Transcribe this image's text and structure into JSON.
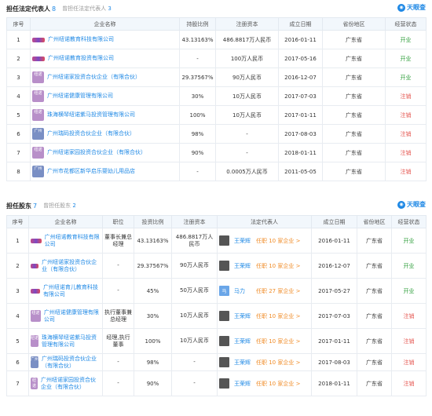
{
  "section1": {
    "title": "担任法定代表人",
    "count": "8",
    "sub_prefix": "曾担任法定代表人",
    "sub_count": "3",
    "logo": "天眼查",
    "headers": [
      "序号",
      "企业名称",
      "持股比例",
      "注册资本",
      "成立日期",
      "省份地区",
      "经营状态"
    ],
    "rows": [
      {
        "no": "1",
        "logo": "",
        "name": "广州纽诺教育科技有限公司",
        "ratio": "43.13163%",
        "capital": "486.8817万人民币",
        "date": "2016-01-11",
        "region": "广东省",
        "status": "开业"
      },
      {
        "no": "2",
        "logo": "",
        "name": "广州纽诺教育投资有限公司",
        "ratio": "-",
        "capital": "100万人民币",
        "date": "2017-05-16",
        "region": "广东省",
        "status": "开业"
      },
      {
        "no": "3",
        "logo": "纽诺",
        "name": "广州纽诺家投资合伙企业（有限合伙）",
        "ratio": "29.37567%",
        "capital": "90万人民币",
        "date": "2016-12-07",
        "region": "广东省",
        "status": "开业"
      },
      {
        "no": "4",
        "logo": "纽诺",
        "name": "广州纽诺健康管理有限公司",
        "ratio": "30%",
        "capital": "10万人民币",
        "date": "2017-07-03",
        "region": "广东省",
        "status": "注销"
      },
      {
        "no": "5",
        "logo": "纽诺",
        "name": "珠海横琴纽诺紫马投资管理有限公司",
        "ratio": "100%",
        "capital": "10万人民币",
        "date": "2017-01-11",
        "region": "广东省",
        "status": "注销"
      },
      {
        "no": "6",
        "logo": "广州",
        "name": "广州瑞码投资合伙企业（有限合伙）",
        "ratio": "98%",
        "capital": "-",
        "date": "2017-08-03",
        "region": "广东省",
        "status": "注销"
      },
      {
        "no": "7",
        "logo": "纽诺",
        "name": "广州纽诺家园投资合伙企业（有限合伙）",
        "ratio": "90%",
        "capital": "-",
        "date": "2018-01-11",
        "region": "广东省",
        "status": "注销"
      },
      {
        "no": "8",
        "logo": "广州",
        "name": "广州市花都区新华启乐婴幼儿用品店",
        "ratio": "-",
        "capital": "0.0005万人民币",
        "date": "2011-05-05",
        "region": "广东省",
        "status": "注销"
      }
    ]
  },
  "section2": {
    "title": "担任股东",
    "count": "7",
    "sub_prefix": "曾担任股东",
    "sub_count": "2",
    "logo": "天眼查",
    "headers": [
      "序号",
      "企业名称",
      "职位",
      "投资比例",
      "注册资本",
      "法定代表人",
      "成立日期",
      "省份地区",
      "经营状态"
    ],
    "rows": [
      {
        "no": "1",
        "logo": "",
        "name": "广州纽诺教育科技有限公司",
        "position": "董事长兼总经理",
        "ratio": "43.13163%",
        "capital": "486.8817万人民币",
        "rep": "王荣辉",
        "rep_avatar": "",
        "rep_jobs": "任职 10 家企业 >",
        "date": "2016-01-11",
        "region": "广东省",
        "status": "开业"
      },
      {
        "no": "2",
        "logo": "",
        "name": "广州纽诺家投资合伙企业（有限合伙）",
        "position": "-",
        "ratio": "29.37567%",
        "capital": "90万人民币",
        "rep": "王荣辉",
        "rep_avatar": "",
        "rep_jobs": "任职 10 家企业 >",
        "date": "2016-12-07",
        "region": "广东省",
        "status": "开业"
      },
      {
        "no": "3",
        "logo": "",
        "name": "广州纽诺育儿教育科技有限公司",
        "position": "-",
        "ratio": "45%",
        "capital": "50万人民币",
        "rep": "马力",
        "rep_avatar": "马",
        "rep_jobs": "任职 27 家企业 >",
        "date": "2017-05-27",
        "region": "广东省",
        "status": "开业"
      },
      {
        "no": "4",
        "logo": "纽诺",
        "name": "广州纽诺健康管理有限公司",
        "position": "执行董事兼总经理",
        "ratio": "30%",
        "capital": "10万人民币",
        "rep": "王荣辉",
        "rep_avatar": "",
        "rep_jobs": "任职 10 家企业 >",
        "date": "2017-07-03",
        "region": "广东省",
        "status": "注销"
      },
      {
        "no": "5",
        "logo": "纽诺",
        "name": "珠海横琴纽诺紫马投资管理有限公司",
        "position": "经理,执行董事",
        "ratio": "100%",
        "capital": "10万人民币",
        "rep": "王荣辉",
        "rep_avatar": "",
        "rep_jobs": "任职 10 家企业 >",
        "date": "2017-01-11",
        "region": "广东省",
        "status": "注销"
      },
      {
        "no": "6",
        "logo": "广州",
        "name": "广州瑞码投资合伙企业（有限合伙）",
        "position": "-",
        "ratio": "98%",
        "capital": "-",
        "rep": "王荣辉",
        "rep_avatar": "",
        "rep_jobs": "任职 10 家企业 >",
        "date": "2017-08-03",
        "region": "广东省",
        "status": "注销"
      },
      {
        "no": "7",
        "logo": "纽诺",
        "name": "广州纽诺家园投资合伙企业（有限合伙）",
        "position": "-",
        "ratio": "90%",
        "capital": "-",
        "rep": "王荣辉",
        "rep_avatar": "",
        "rep_jobs": "任职 10 家企业 >",
        "date": "2018-01-11",
        "region": "广东省",
        "status": "注销"
      }
    ]
  },
  "colors": {
    "accent": "#1e88e5",
    "open": "#2e9e3a",
    "cancel": "#e5554f",
    "job": "#f08c28",
    "header_bg": "#f2f7fc"
  }
}
